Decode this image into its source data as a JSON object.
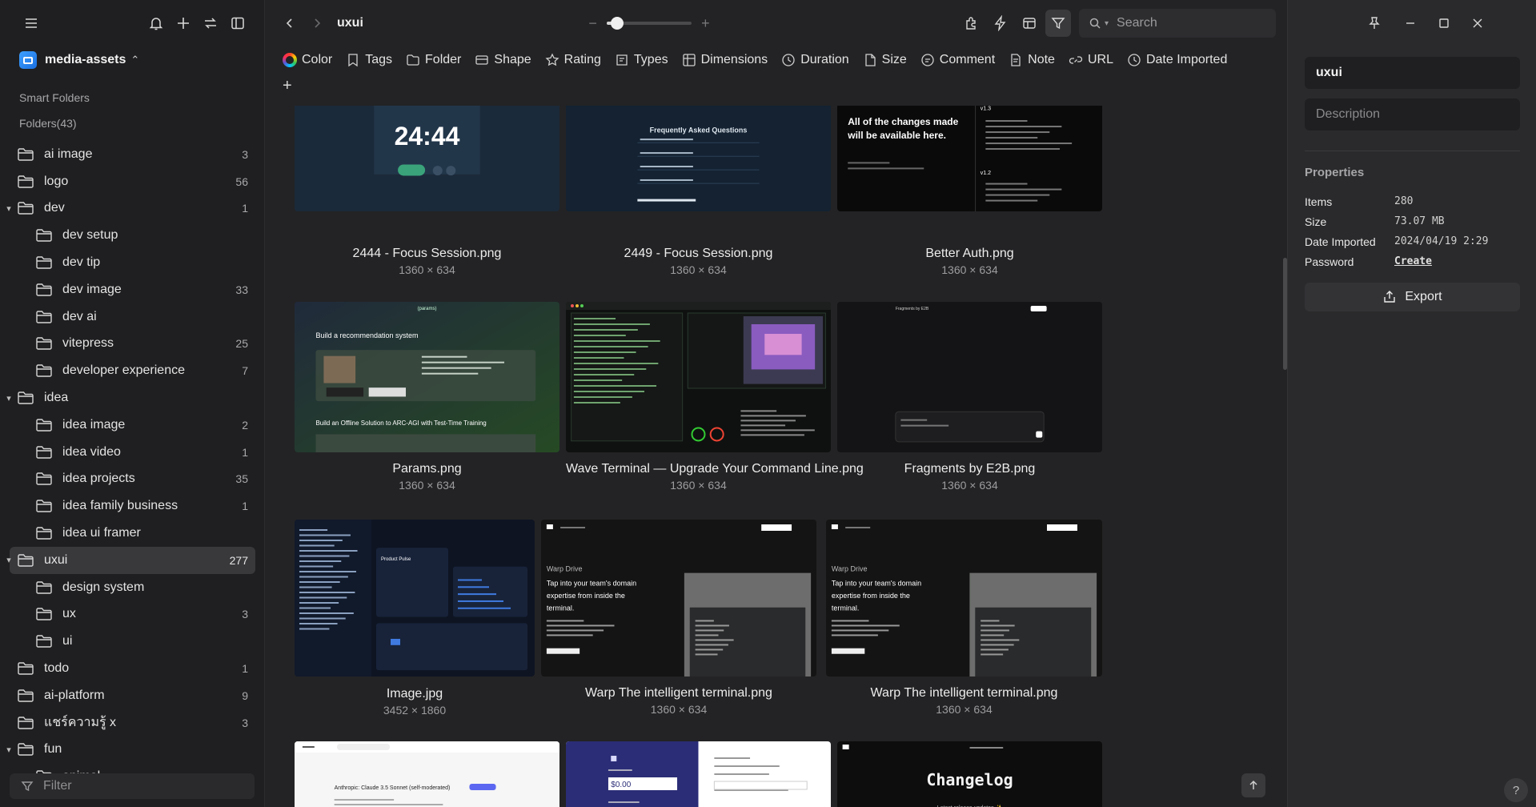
{
  "sidebar": {
    "library": {
      "name": "media-assets"
    },
    "smart_folders_label": "Smart Folders",
    "folders_label": "Folders(43)",
    "filter_placeholder": "Filter",
    "tree": [
      {
        "label": "ai image",
        "count": "3",
        "depth": 0,
        "expanded": null,
        "selected": false
      },
      {
        "label": "logo",
        "count": "56",
        "depth": 0,
        "expanded": null,
        "selected": false
      },
      {
        "label": "dev",
        "count": "1",
        "depth": 0,
        "expanded": true,
        "selected": false
      },
      {
        "label": "dev setup",
        "count": "",
        "depth": 1,
        "expanded": null,
        "selected": false
      },
      {
        "label": "dev tip",
        "count": "",
        "depth": 1,
        "expanded": null,
        "selected": false
      },
      {
        "label": "dev image",
        "count": "33",
        "depth": 1,
        "expanded": null,
        "selected": false
      },
      {
        "label": "dev ai",
        "count": "",
        "depth": 1,
        "expanded": null,
        "selected": false
      },
      {
        "label": "vitepress",
        "count": "25",
        "depth": 1,
        "expanded": null,
        "selected": false
      },
      {
        "label": "developer experience",
        "count": "7",
        "depth": 1,
        "expanded": null,
        "selected": false
      },
      {
        "label": "idea",
        "count": "",
        "depth": 0,
        "expanded": true,
        "selected": false
      },
      {
        "label": "idea image",
        "count": "2",
        "depth": 1,
        "expanded": null,
        "selected": false
      },
      {
        "label": "idea video",
        "count": "1",
        "depth": 1,
        "expanded": null,
        "selected": false
      },
      {
        "label": "idea projects",
        "count": "35",
        "depth": 1,
        "expanded": null,
        "selected": false
      },
      {
        "label": "idea family business",
        "count": "1",
        "depth": 1,
        "expanded": null,
        "selected": false
      },
      {
        "label": "idea ui framer",
        "count": "",
        "depth": 1,
        "expanded": null,
        "selected": false
      },
      {
        "label": "uxui",
        "count": "277",
        "depth": 0,
        "expanded": true,
        "selected": true
      },
      {
        "label": "design system",
        "count": "",
        "depth": 1,
        "expanded": null,
        "selected": false
      },
      {
        "label": "ux",
        "count": "3",
        "depth": 1,
        "expanded": null,
        "selected": false
      },
      {
        "label": "ui",
        "count": "",
        "depth": 1,
        "expanded": null,
        "selected": false
      },
      {
        "label": "todo",
        "count": "1",
        "depth": 0,
        "expanded": null,
        "selected": false
      },
      {
        "label": "ai-platform",
        "count": "9",
        "depth": 0,
        "expanded": null,
        "selected": false
      },
      {
        "label": "แชร์ความรู้ x",
        "count": "3",
        "depth": 0,
        "expanded": null,
        "selected": false
      },
      {
        "label": "fun",
        "count": "",
        "depth": 0,
        "expanded": true,
        "selected": false
      },
      {
        "label": "animal",
        "count": "",
        "depth": 1,
        "expanded": null,
        "selected": false
      }
    ]
  },
  "toolbar": {
    "folder_title": "uxui",
    "search_placeholder": "Search",
    "zoom_level": 0.12
  },
  "filters": [
    "Color",
    "Tags",
    "Folder",
    "Shape",
    "Rating",
    "Types",
    "Dimensions",
    "Duration",
    "Size",
    "Comment",
    "Note",
    "URL",
    "Date Imported"
  ],
  "grid": {
    "items": [
      {
        "name": "2444 - Focus Session.png",
        "dims": "1360 × 634",
        "thumb_text": "24:44",
        "theme": "focus"
      },
      {
        "name": "2449 - Focus Session.png",
        "dims": "1360 × 634",
        "thumb_text": "Frequently Asked Questions",
        "theme": "faq"
      },
      {
        "name": "Better Auth.png",
        "dims": "1360 × 634",
        "thumb_text": "All of the changes made will be available here.",
        "theme": "changes"
      },
      {
        "name": "Params.png",
        "dims": "1360 × 634",
        "thumb_text": "Build a recommendation system",
        "theme": "params"
      },
      {
        "name": "Wave Terminal — Upgrade Your Command Line.png",
        "dims": "1360 × 634",
        "thumb_text": "",
        "theme": "wave"
      },
      {
        "name": "Fragments by E2B.png",
        "dims": "1360 × 634",
        "thumb_text": "",
        "theme": "fragments"
      },
      {
        "name": "Image.jpg",
        "dims": "3452 × 1860",
        "thumb_text": "Product Pulse",
        "theme": "dash"
      },
      {
        "name": "Warp The intelligent terminal.png",
        "dims": "1360 × 634",
        "thumb_text": "Tap into your team's domain expertise from inside the terminal.",
        "theme": "warp"
      },
      {
        "name": "Warp The intelligent terminal.png",
        "dims": "1360 × 634",
        "thumb_text": "Tap into your team's domain expertise from inside the terminal.",
        "theme": "warp"
      },
      {
        "name": "",
        "dims": "",
        "thumb_text": "Anthropic: Claude 3.5 Sonnet (self-moderated)",
        "theme": "light"
      },
      {
        "name": "",
        "dims": "",
        "thumb_text": "$0.00",
        "theme": "pay"
      },
      {
        "name": "",
        "dims": "",
        "thumb_text": "Changelog",
        "theme": "changelog"
      }
    ]
  },
  "panel": {
    "name_value": "uxui",
    "description_placeholder": "Description",
    "properties_title": "Properties",
    "properties": [
      {
        "key": "Items",
        "value": "280"
      },
      {
        "key": "Size",
        "value": "73.07 MB"
      },
      {
        "key": "Date Imported",
        "value": "2024/04/19 2:29"
      },
      {
        "key": "Password",
        "value": "Create"
      }
    ],
    "export_label": "Export"
  }
}
